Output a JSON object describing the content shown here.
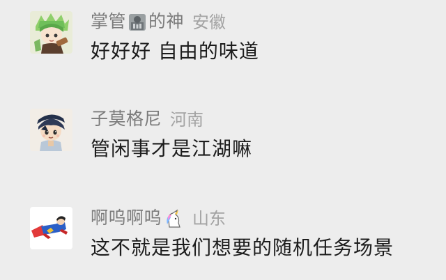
{
  "comments": [
    {
      "username_part1": "掌管",
      "name_emoji": "statue-emoji",
      "username_part2": "的神",
      "location": "安徽",
      "text": "好好好 自由的味道",
      "avatar": "anime-character-avatar"
    },
    {
      "username": "子莫格尼",
      "location": "河南",
      "text": "管闲事才是江湖嘛",
      "avatar": "cartoon-boy-avatar"
    },
    {
      "username": "啊呜啊呜",
      "name_emoji": "unicorn-emoji",
      "location": "山东",
      "text": "这不就是我们想要的随机任务场景",
      "avatar": "flying-superhero-avatar"
    }
  ],
  "colors": {
    "background": "#ededed",
    "username": "#7b7b7b",
    "location": "#a3a3a3",
    "text": "#1c1c1c"
  }
}
